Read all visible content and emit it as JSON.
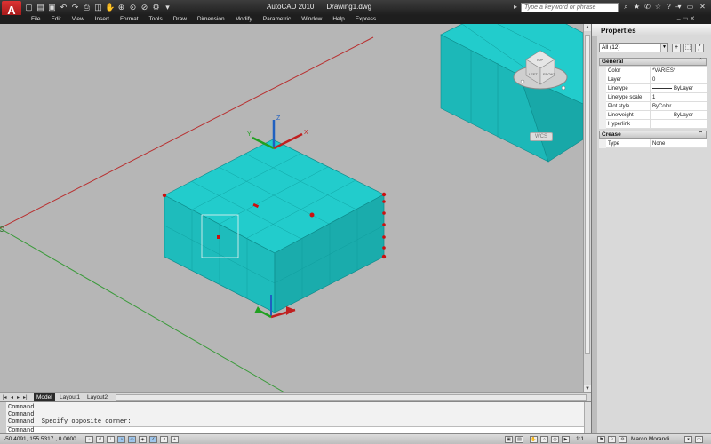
{
  "app": {
    "title": "AutoCAD 2010",
    "document": "Drawing1.dwg",
    "logo_letter": "A"
  },
  "search": {
    "placeholder": "Type a keyword or phrase"
  },
  "menu": [
    "File",
    "Edit",
    "View",
    "Insert",
    "Format",
    "Tools",
    "Draw",
    "Dimension",
    "Modify",
    "Parametric",
    "Window",
    "Help",
    "Express"
  ],
  "viewcube": {
    "face_top": "TOP",
    "face_left": "LEFT",
    "face_front": "FRONT",
    "wcs_label": "WCS"
  },
  "ucs": {
    "z": "Z",
    "x": "X",
    "y": "Y"
  },
  "tabs": {
    "model": "Model",
    "layout1": "Layout1",
    "layout2": "Layout2"
  },
  "command": {
    "lines": [
      "Command:",
      "Command:",
      "Command: Specify opposite corner:"
    ],
    "prompt": "Command:"
  },
  "status": {
    "coords": "-50.4091, 155.5317 , 0.0000",
    "annotation_scale": "1:1",
    "user": "Marco Morandi"
  },
  "properties": {
    "title": "Properties",
    "selection": "All (12)",
    "sections": {
      "general": "General",
      "crease": "Crease"
    },
    "general_rows": [
      {
        "name": "Color",
        "value": "*VARIES*"
      },
      {
        "name": "Layer",
        "value": "0"
      },
      {
        "name": "Linetype",
        "value": "ByLayer"
      },
      {
        "name": "Linetype scale",
        "value": "1"
      },
      {
        "name": "Plot style",
        "value": "ByColor"
      },
      {
        "name": "Lineweight",
        "value": "ByLayer"
      },
      {
        "name": "Hyperlink",
        "value": ""
      }
    ],
    "crease_rows": [
      {
        "name": "Type",
        "value": "None"
      }
    ]
  },
  "colors": {
    "box_face": "#20c8c8",
    "box_edge": "#0e8c8c",
    "grip": "#cc1010",
    "viewport_bg": "#b6b6b6",
    "axis_red": "#b83030",
    "axis_green": "#3a9a3a"
  }
}
